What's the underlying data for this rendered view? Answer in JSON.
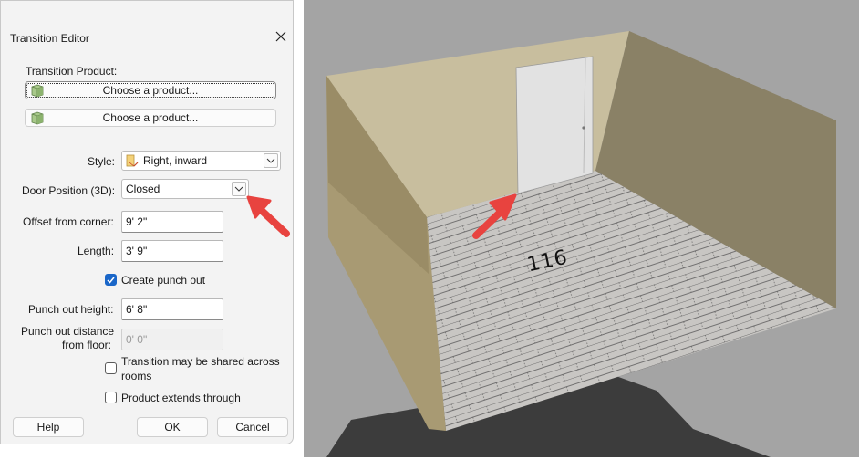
{
  "dialog": {
    "title": "Transition Editor",
    "transition_product_label": "Transition Product:",
    "product_button_1": "Choose a product...",
    "product_button_2": "Choose a product...",
    "style_label": "Style:",
    "style_value": "Right, inward",
    "door_position_label": "Door Position (3D):",
    "door_position_value": "Closed",
    "offset_label": "Offset from corner:",
    "offset_value": "9' 2\"",
    "length_label": "Length:",
    "length_value": "3' 9\"",
    "create_punch_out_label": "Create punch out",
    "create_punch_out_checked": true,
    "punch_height_label": "Punch out height:",
    "punch_height_value": "6' 8\"",
    "punch_distance_label_1": "Punch out distance",
    "punch_distance_label_2": "from floor:",
    "punch_distance_value": "0' 0\"",
    "shared_label_1": "Transition may be shared across",
    "shared_label_2": "rooms",
    "shared_checked": false,
    "extends_label": "Product extends through",
    "extends_checked": false,
    "help_button": "Help",
    "ok_button": "OK",
    "cancel_button": "Cancel"
  },
  "view3d": {
    "room_number": "116",
    "annotation_color": "#e8433f"
  }
}
